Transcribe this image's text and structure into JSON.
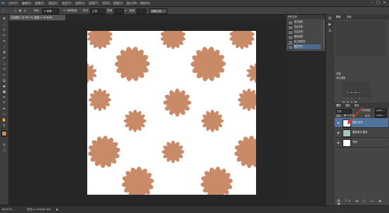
{
  "menu": [
    "文件(F)",
    "编辑(E)",
    "图像(I)",
    "图层(L)",
    "类型(Y)",
    "选择(S)",
    "滤镜(T)",
    "3D(D)",
    "视图(V)",
    "窗口(W)",
    "帮助(H)"
  ],
  "options": {
    "feather_label": "羽化:",
    "feather_value": "0 像素",
    "antialias_label": "消除锯齿",
    "style_label": "样式:",
    "style_value": "正常",
    "width_label": "宽度:",
    "height_label": "高度:",
    "refine_button": "调整边缘..."
  },
  "document_tab": "未标题-1 @ 66.7% (图层 0, RGB/8)",
  "history": {
    "title": "历史记录",
    "items": [
      "填充图层",
      "自由变换",
      "自由变换",
      "删除图层",
      "建立图层组",
      "图层样式"
    ],
    "selected_index": 5
  },
  "right_panel": {
    "tabs": [
      "颜色",
      "色板"
    ],
    "adjust_title": "调整",
    "adjust_label": "添加调整",
    "layers_tabs": [
      "图层",
      "通道",
      "路径"
    ],
    "blend_mode": "正常",
    "opacity_label": "不透明度:",
    "opacity_value": "100%",
    "lock_label": "锁定:",
    "fill_label": "填充:",
    "fill_value": "100%",
    "layers": [
      {
        "name": "图案 填充",
        "selected": true
      },
      {
        "name": "图案填充 副本",
        "selected": false
      },
      {
        "name": "背景",
        "selected": false
      }
    ]
  },
  "status": {
    "zoom": "66.67%",
    "doc": "文档:4.12M/42.3M"
  },
  "colors": {
    "flower": "#c98a68",
    "selection": "#52749c"
  }
}
